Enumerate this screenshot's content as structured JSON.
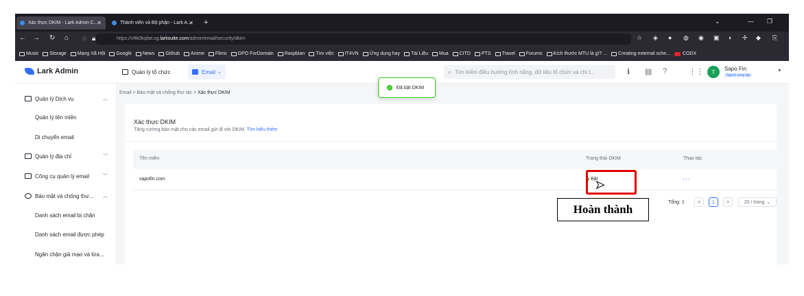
{
  "browser": {
    "tabs": [
      {
        "title": "Xác thực DKIM - Lark Admin C...",
        "active": true
      },
      {
        "title": "Thành viên và Bộ phận - Lark A...",
        "active": false
      }
    ],
    "url_prefix": "https://vftk0kqilat.sg.",
    "url_domain": "larksuite.com",
    "url_path": "/admin/email/security/dkim",
    "bookmarks": [
      "Music",
      "Storage",
      "Mạng Xã Hội",
      "Google",
      "News",
      "Github",
      "Anime",
      "Flims",
      "GPO ForDomain",
      "Raspbian",
      "Tìm việc",
      "IT4VN",
      "Ứng dụng hay",
      "Tài Liệu",
      "Mua",
      "CITD",
      "PTS",
      "Travel",
      "Forums",
      "Kích thước MTU là gì? ...",
      "Creating external sche...",
      "CODX"
    ]
  },
  "header": {
    "logo": "Lark Admin",
    "nav": [
      "Quản lý tổ chức",
      "Email"
    ],
    "search_placeholder": "Tìm kiếm điều hướng tính năng, dữ liệu tổ chức và chi t...",
    "user_initial": "T",
    "user_name": "Sapo Fin",
    "user_role": "Người sáng lập"
  },
  "sidebar": {
    "items": [
      {
        "label": "Quản lý Dịch vụ",
        "chevron": "^"
      },
      {
        "label": "Quản lý tên miền"
      },
      {
        "label": "Di chuyển email"
      },
      {
        "label": "Quản lý địa chỉ",
        "chevron": "v"
      },
      {
        "label": "Công cụ quản lý email",
        "chevron": "v"
      },
      {
        "label": "Bảo mật và chống thư...",
        "chevron": "^"
      },
      {
        "label": "Danh sách email bị chặn"
      },
      {
        "label": "Danh sách email được phép"
      },
      {
        "label": "Ngăn chặn giả mạo và lừa..."
      }
    ]
  },
  "breadcrumb": {
    "items": [
      "Email",
      "Bảo mật và chống thư rác",
      "Xác thực DKIM"
    ],
    "sep": ">"
  },
  "card": {
    "title": "Xác thực DKIM",
    "description": "Tăng cường bảo mật cho các email gửi đi với DKIM.",
    "link": "Tìm hiểu thêm"
  },
  "table": {
    "headers": [
      "Tên miền",
      "Trạng thái DKIM",
      "Thao tác"
    ],
    "rows": [
      {
        "domain": "sapofin.com",
        "status": "Bật",
        "action": "..."
      }
    ]
  },
  "pagination": {
    "total": "Tổng: 1",
    "prev": "<",
    "page": "1",
    "next": ">",
    "page_size": "20 / trang"
  },
  "toast": {
    "text": "Đã bật DKIM"
  },
  "annotation": {
    "text": "Hoàn thành"
  },
  "colors": {
    "accent": "#3370ff",
    "success": "#34c724",
    "highlight": "#e00000"
  }
}
